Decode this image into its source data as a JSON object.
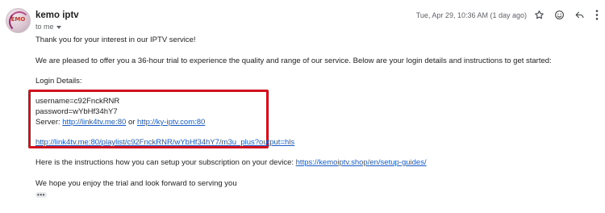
{
  "sender": {
    "name": "kemo iptv",
    "avatar_text": "EMO",
    "to_label": "to me"
  },
  "timestamp": "Tue, Apr 29, 10:36 AM (1 day ago)",
  "icons": [
    "star-icon",
    "emoji-reaction-icon",
    "reply-icon",
    "more-vert-icon",
    "chevron-down-icon"
  ],
  "body": {
    "greeting": "Thank you for your interest in our IPTV service!",
    "intro": "We are pleased to offer you a 36-hour trial to experience the quality and range of our service. Below are your login details and instructions to get started:",
    "login_heading": "Login Details:",
    "username": "username=c92FnckRNR",
    "password": "password=wYbHf34hY7",
    "server_label": "Server:",
    "server_link_1": "http://link4tv.me:80",
    "server_or": "or",
    "server_link_2": "http://ky-iptv.com:80",
    "playlist_link": "http://link4tv.me:80/playlist/c92FnckRNR/wYbHf34hY7/m3u_plus?output=hls",
    "instructions_text": "Here is the instructions how you can setup your subscription on your device:",
    "instructions_link": "https://kemoiptv.shop/en/setup-guides/",
    "closing": "We hope you enjoy the trial and look forward to serving you",
    "ellipsis": "•••"
  },
  "colors": {
    "link": "#1a5bc8",
    "highlight": "#d1121f",
    "meta": "#5f6368"
  }
}
